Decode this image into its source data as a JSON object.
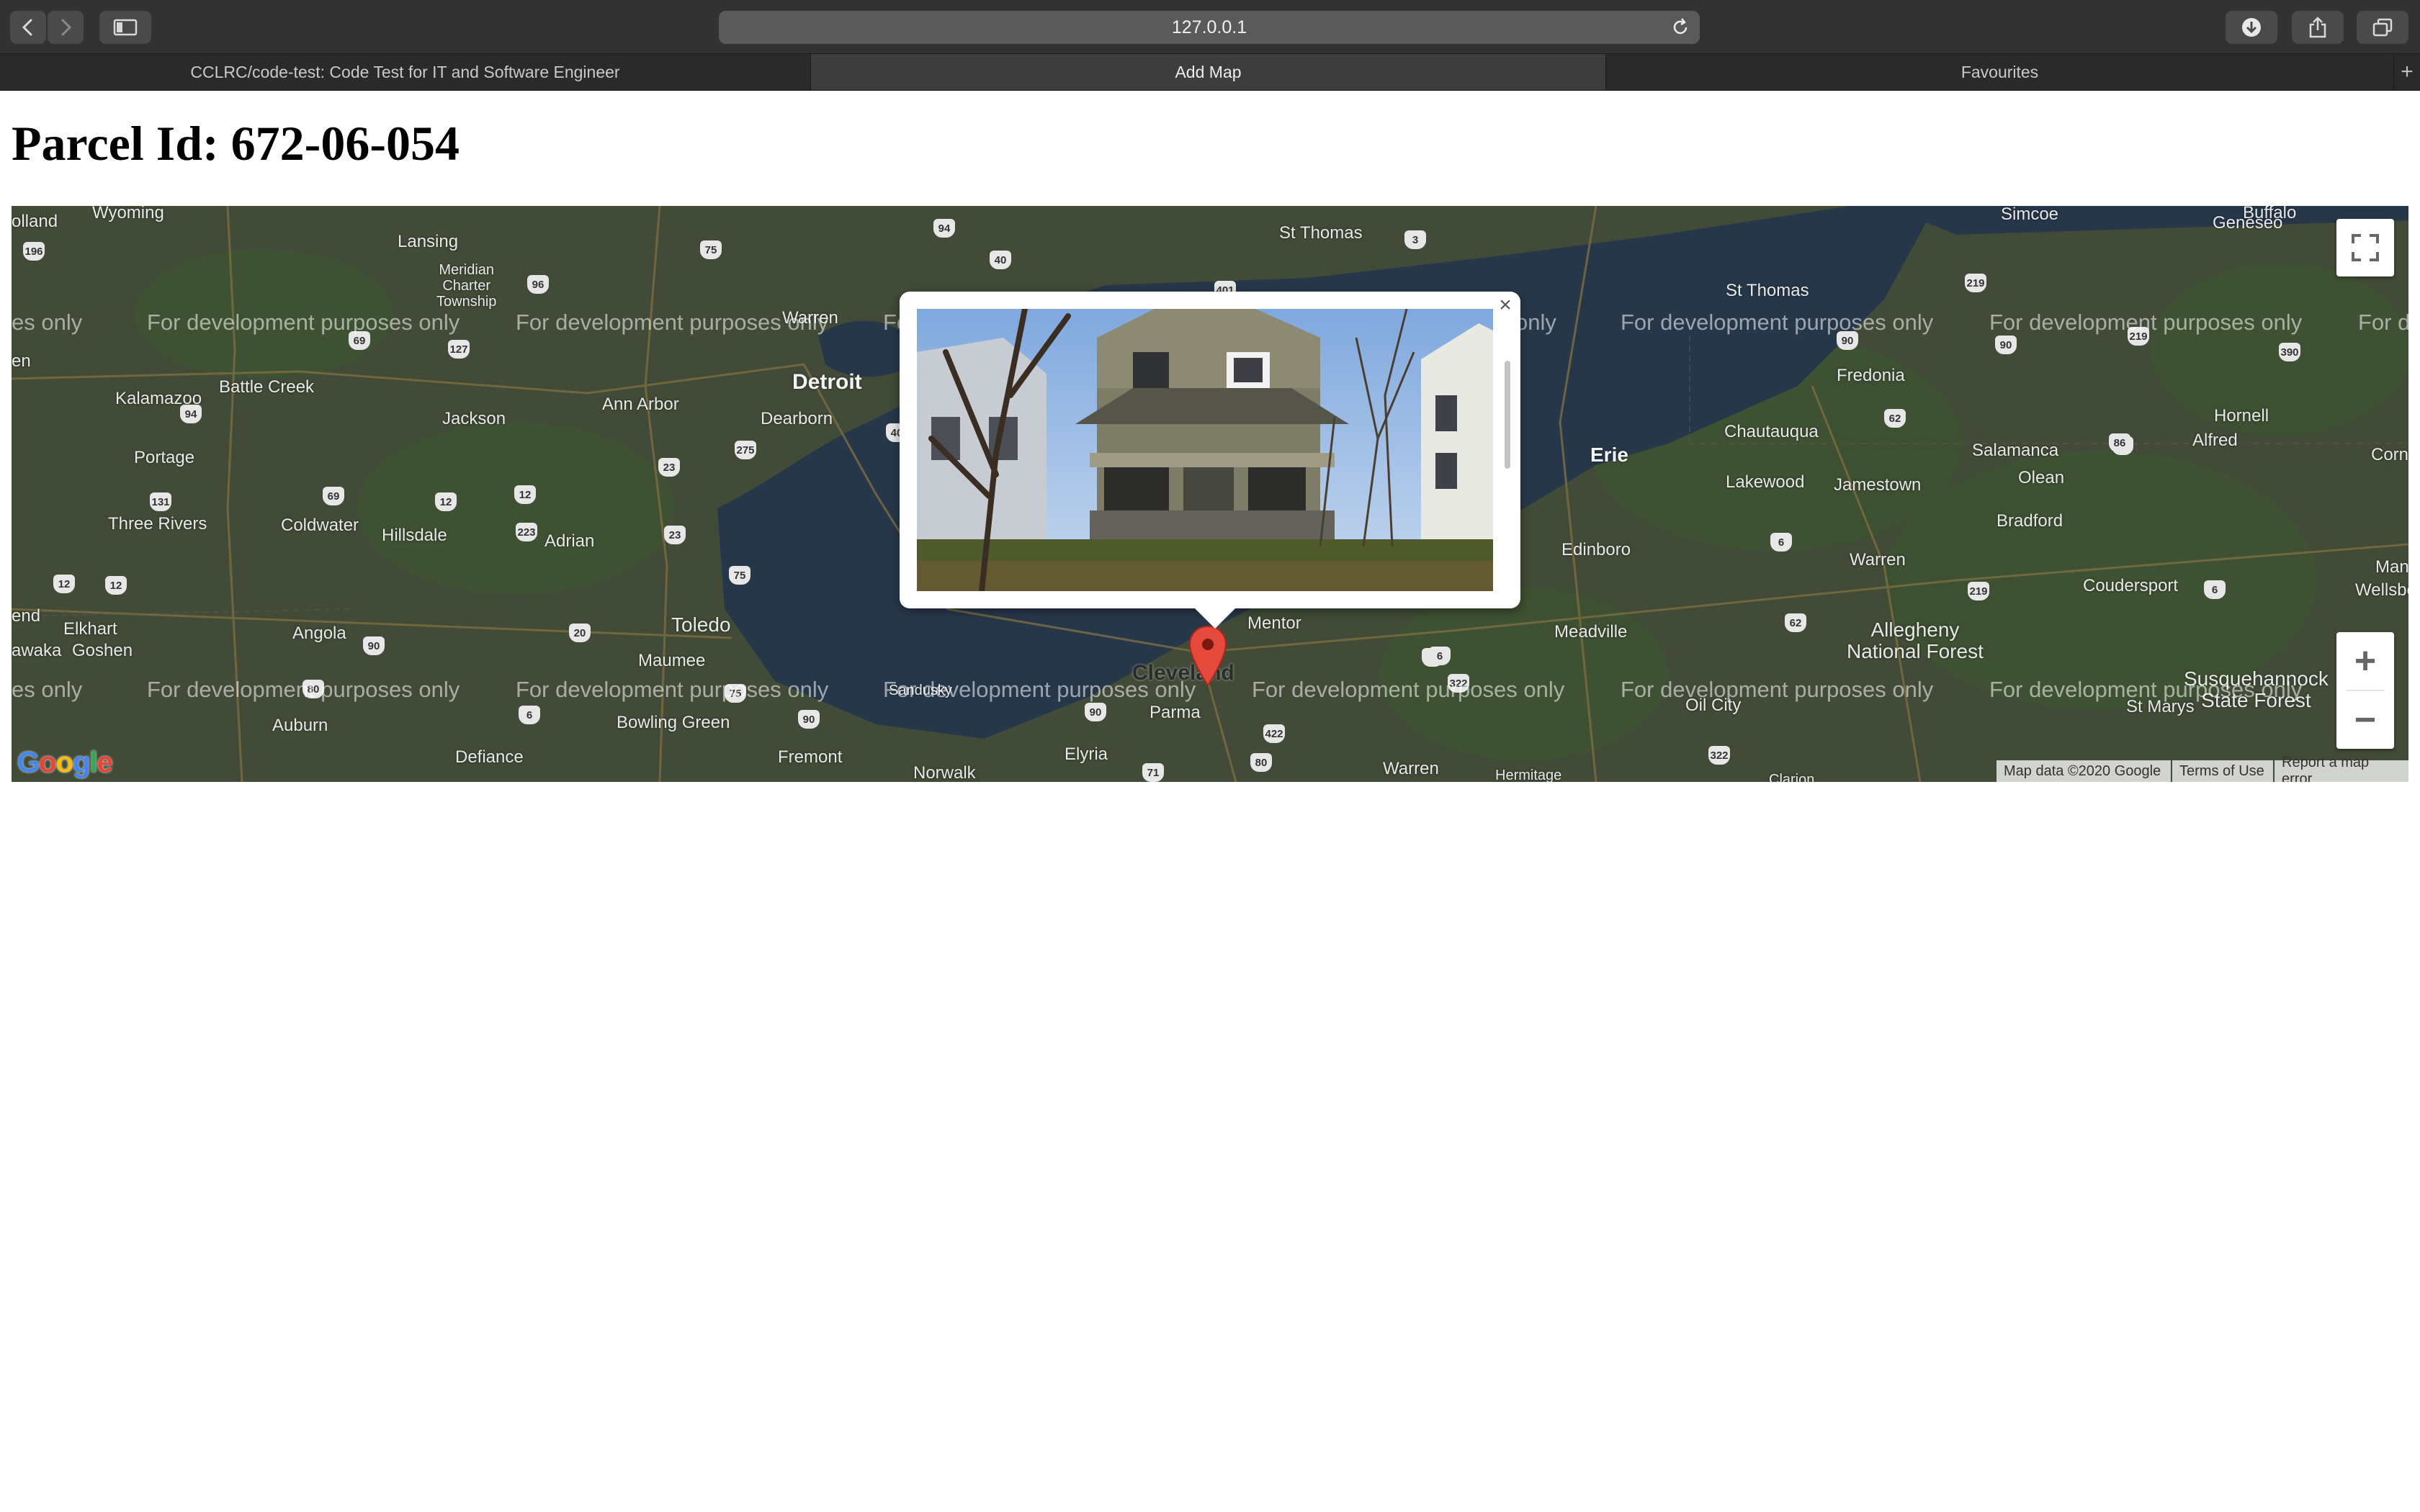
{
  "browser": {
    "url": "127.0.0.1",
    "tabs": [
      {
        "label": "CCLRC/code-test: Code Test for IT and Software Engineer",
        "active": false
      },
      {
        "label": "Add Map",
        "active": true
      },
      {
        "label": "Favourites",
        "active": false
      }
    ],
    "new_tab_label": "+"
  },
  "page": {
    "title": "Parcel Id: 672-06-054"
  },
  "map": {
    "watermark": "For development purposes only",
    "watermark_left_fragment": "es only",
    "watermark_right_fragment": "For d",
    "watermark_split_a": "Fo",
    "watermark_split_b": "only",
    "cities": {
      "detroit": "Detroit",
      "cleveland": "Cleveland",
      "toledo": "Toledo",
      "erie": "Erie",
      "lansing": "Lansing",
      "ann_arbor": "Ann Arbor",
      "dearborn": "Dearborn",
      "kalamazoo": "Kalamazoo",
      "battle_creek": "Battle Creek",
      "jackson": "Jackson",
      "portage": "Portage",
      "three_rivers": "Three Rivers",
      "coldwater": "Coldwater",
      "hillsdale": "Hillsdale",
      "adrian": "Adrian",
      "elkhart": "Elkhart",
      "goshen": "Goshen",
      "angola": "Angola",
      "auburn": "Auburn",
      "defiance": "Defiance",
      "bowling_green": "Bowling Green",
      "maumee": "Maumee",
      "fremont": "Fremont",
      "norwalk": "Norwalk",
      "elyria": "Elyria",
      "parma": "Parma",
      "mentor": "Mentor",
      "warren_oh": "Warren",
      "hermitage": "Hermitage",
      "meadville": "Meadville",
      "edinboro": "Edinboro",
      "warren_pa": "Warren",
      "oil_city": "Oil City",
      "allegheny": "Allegheny\nNational Forest",
      "bradford": "Bradford",
      "coudersport": "Coudersport",
      "wellsboro": "Wellsboro",
      "st_marys": "St Marys",
      "susquehannock": "Susquehannock\nState Forest",
      "jamestown": "Jamestown",
      "lakewood": "Lakewood",
      "chautauqua": "Chautauqua",
      "fredonia": "Fredonia",
      "salamanca": "Salamanca",
      "olean": "Olean",
      "hornell": "Hornell",
      "alfred": "Alfred",
      "corning": "Corni",
      "geneseo": "Geneseo",
      "buffalo": "Buffalo",
      "simcoe": "Simcoe",
      "st_thomas": "St Thomas",
      "wyoming": "Wyoming",
      "holland": "olland",
      "charter": "Meridian\nCharter\nTownship",
      "warren_mi": "Warren",
      "mansfield": "Mansfi",
      "kawaka": "awaka",
      "end": "end",
      "en": "en",
      "sandusky": "Sandusky",
      "clarion": "Clarion"
    },
    "highways": [
      "196",
      "94",
      "69",
      "127",
      "96",
      "75",
      "94",
      "40",
      "3",
      "401",
      "40",
      "275",
      "23",
      "12",
      "12",
      "223",
      "23",
      "131",
      "69",
      "12",
      "75",
      "20",
      "90",
      "80",
      "6",
      "75",
      "90",
      "90",
      "6",
      "422",
      "80",
      "71",
      "322",
      "322",
      "6",
      "90",
      "62",
      "219",
      "62",
      "86",
      "6",
      "219",
      "6",
      "90",
      "219",
      "390",
      "86",
      "12"
    ],
    "attribution": {
      "map_data": "Map data ©2020 Google",
      "terms": "Terms of Use",
      "report": "Report a map error"
    },
    "logo_text": "Google",
    "controls": {
      "fullscreen": "fullscreen-icon",
      "zoom_in": "+",
      "zoom_out": "−"
    },
    "popup": {
      "close": "×",
      "photo_alt": "house photo"
    },
    "colors": {
      "water": "#3f5a78",
      "land": "#5f6b52",
      "marker": "#e5493b"
    }
  }
}
